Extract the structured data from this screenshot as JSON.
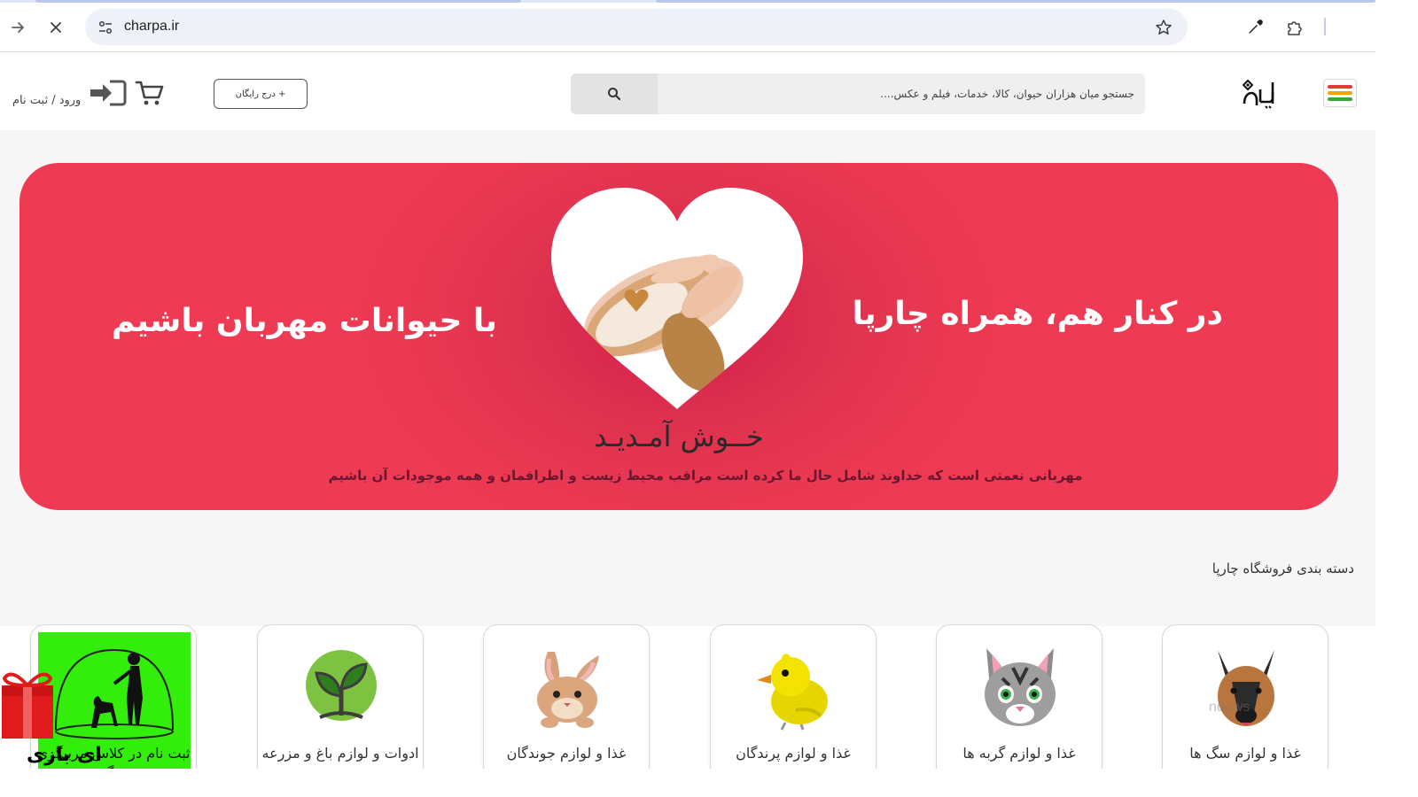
{
  "browser": {
    "url": "charpa.ir",
    "back_icon": "arrow-forward-icon",
    "stop_icon": "close-icon"
  },
  "header": {
    "search_placeholder": "جستجو میان هزاران حیوان، کالا، خدمات، فیلم و عکس....",
    "free_ad_button": "+ درج رایگان",
    "login_label": "ورود / ثبت نام",
    "menu_colors": [
      "#e23b3b",
      "#f0a500",
      "#3aa53a"
    ]
  },
  "banner": {
    "title_right": "در کنار هم، همراه چارپا",
    "title_left": "با حیوانات مهربان باشیم",
    "welcome": "خــوش آمـدیـد",
    "subtitle": "مهربانی نعمتی است که خداوند شامل حال ما کرده است  مراقب محیط زیست و اطرافمان و همه موجودات آن باشیم",
    "background_color": "#ee3a53"
  },
  "categories": {
    "title": "دسته بندی فروشگاه چارپا",
    "items": [
      {
        "label": "غذا و لوازم سگ ها",
        "icon": "dog-icon"
      },
      {
        "label": "غذا و لوازم گربه ها",
        "icon": "cat-icon"
      },
      {
        "label": "غذا و لوازم پرندگان",
        "icon": "bird-icon"
      },
      {
        "label": "غذا و لوازم جوندگان",
        "icon": "rabbit-icon"
      },
      {
        "label": "ادوات و لوازم باغ و مزرعه",
        "icon": "plant-icon"
      },
      {
        "label": "ثبت نام در کلاس مربیگری سگ",
        "icon": "dog-trainer-icon"
      }
    ]
  },
  "overlay": {
    "watermark": "ای بازی",
    "activate_text": "ndows"
  }
}
